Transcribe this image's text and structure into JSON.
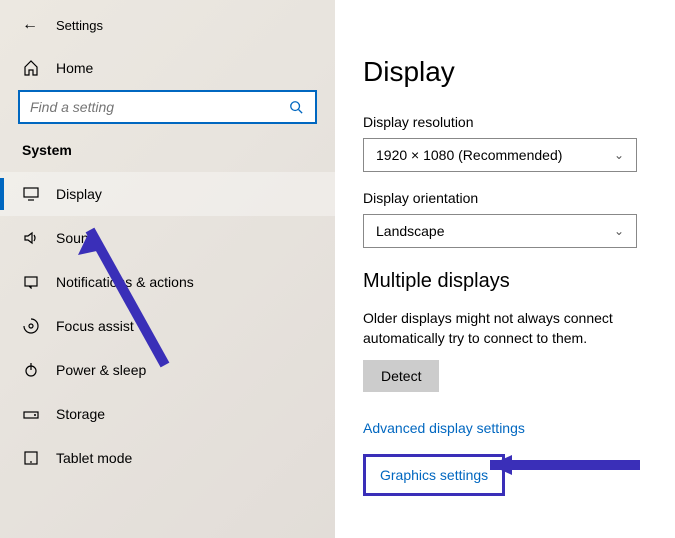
{
  "header": {
    "settings_label": "Settings"
  },
  "sidebar": {
    "home_label": "Home",
    "search_placeholder": "Find a setting",
    "system_label": "System",
    "items": [
      {
        "label": "Display"
      },
      {
        "label": "Sound"
      },
      {
        "label": "Notifications & actions"
      },
      {
        "label": "Focus assist"
      },
      {
        "label": "Power & sleep"
      },
      {
        "label": "Storage"
      },
      {
        "label": "Tablet mode"
      }
    ]
  },
  "main": {
    "title": "Display",
    "resolution_label": "Display resolution",
    "resolution_value": "1920 × 1080 (Recommended)",
    "orientation_label": "Display orientation",
    "orientation_value": "Landscape",
    "multiple_title": "Multiple displays",
    "multiple_text": "Older displays might not always connect automatically try to connect to them.",
    "detect_label": "Detect",
    "advanced_link": "Advanced display settings",
    "graphics_link": "Graphics settings"
  }
}
